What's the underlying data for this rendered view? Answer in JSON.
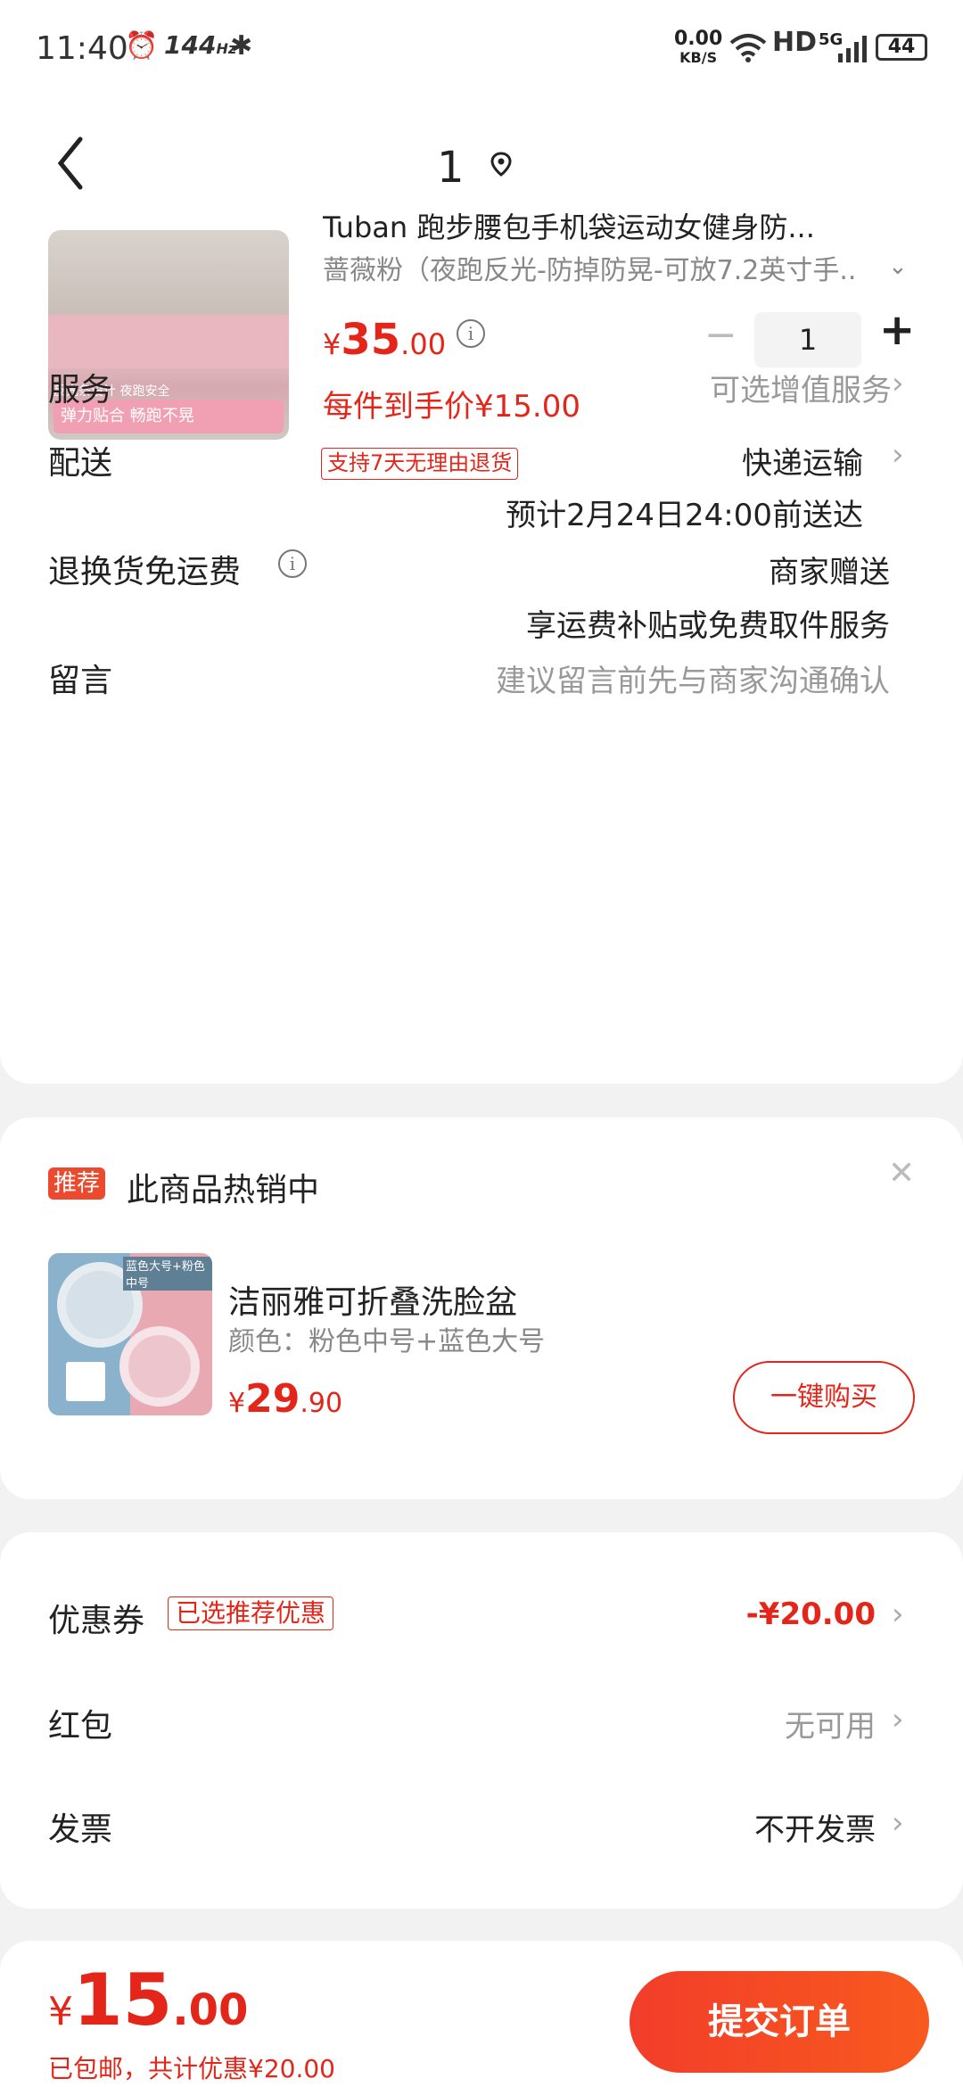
{
  "status_bar": {
    "time": "11:40",
    "refresh_rate": "144",
    "refresh_unit": "Hz",
    "net_speed": "0.00",
    "net_unit": "KB/S",
    "hd": "HD",
    "signal": "5G",
    "battery": "44"
  },
  "nav": {
    "title": "1"
  },
  "product": {
    "title": "Tuban 跑步腰包手机袋运动女健身防...",
    "variant": "蔷薇粉（夜跑反光-防掉防晃-可放7.2英寸手...",
    "thumb_text_1": "反光条设计 夜跑安全",
    "thumb_text_2": "弹力贴合 畅跑不晃",
    "price_symbol": "¥",
    "price_int": "35",
    "price_dec": ".00",
    "quantity": "1",
    "unit_price": "每件到手价¥15.00",
    "return_badge": "支持7天无理由退货"
  },
  "rows": {
    "service_label": "服务",
    "service_value": "可选增值服务",
    "delivery_label": "配送",
    "delivery_value": "快递运输",
    "delivery_eta": "预计2月24日24:00前送达",
    "return_label": "退换货免运费",
    "return_value": "商家赠送",
    "return_desc": "享运费补贴或免费取件服务",
    "message_label": "留言",
    "message_placeholder": "建议留言前先与商家沟通确认"
  },
  "recommend": {
    "badge": "推荐",
    "title": "此商品热销中",
    "name": "洁丽雅可折叠洗脸盆",
    "spec": "颜色：粉色中号+蓝色大号",
    "price_symbol": "¥",
    "price_int": "29",
    "price_dec": ".90",
    "thumb_text": "蓝色大号+粉色中号",
    "buy_label": "一键购买"
  },
  "discounts": {
    "coupon_label": "优惠券",
    "coupon_badge": "已选推荐优惠",
    "coupon_value": "-¥20.00",
    "redpacket_label": "红包",
    "redpacket_value": "无可用",
    "invoice_label": "发票",
    "invoice_value": "不开发票"
  },
  "bottom": {
    "total_symbol": "¥",
    "total_int": "15",
    "total_dec": ".00",
    "sub_total": "已包邮，共计优惠¥20.00",
    "submit_label": "提交订单"
  },
  "colors": {
    "accent": "#e4261a",
    "background": "#f2f2f2"
  }
}
